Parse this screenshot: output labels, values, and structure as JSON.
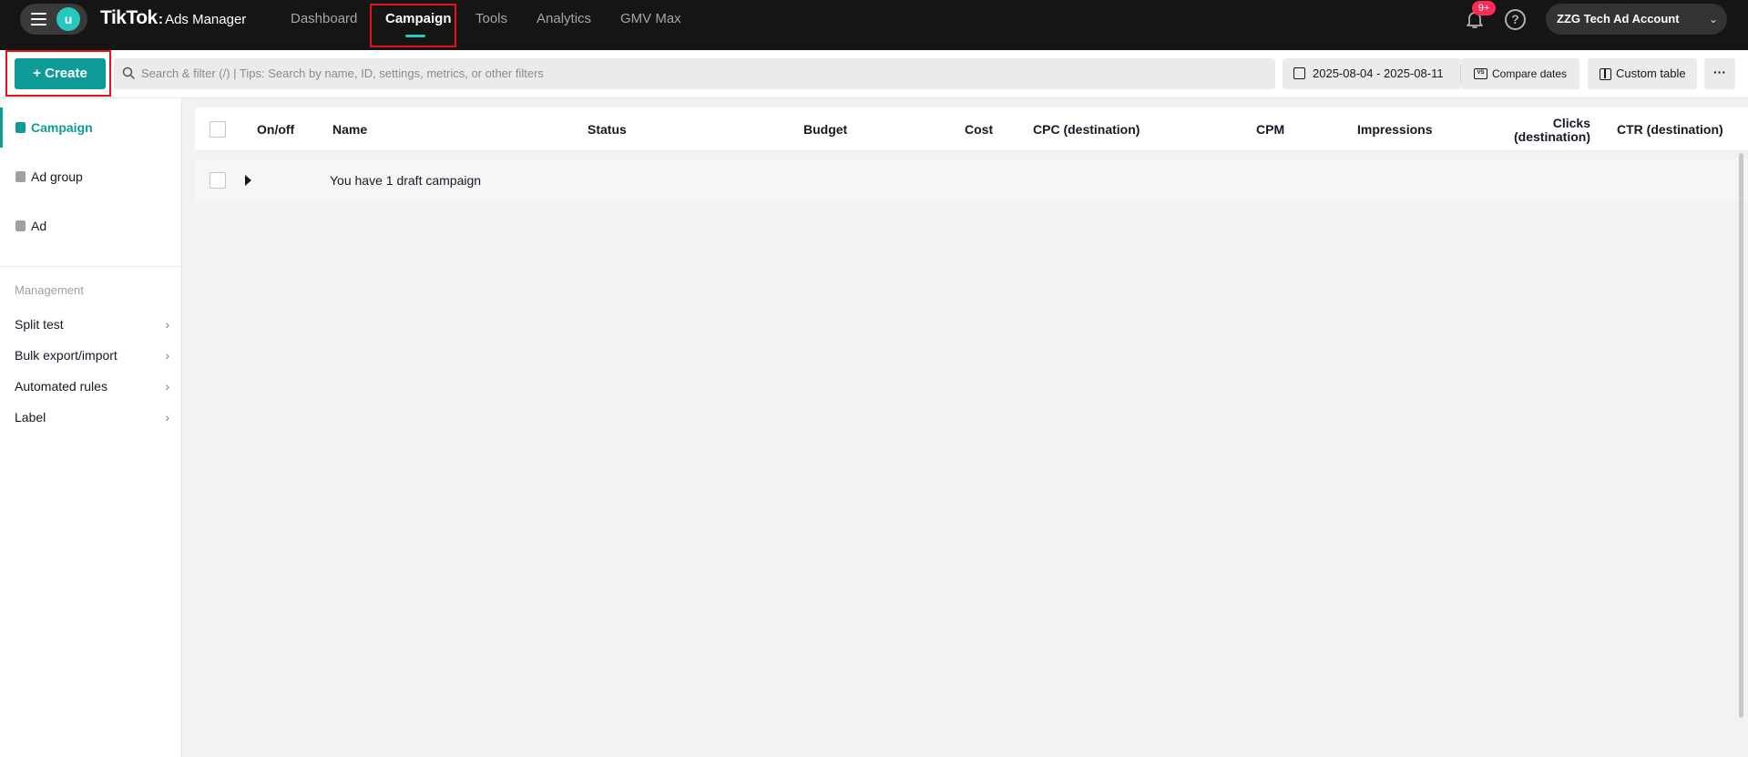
{
  "topbar": {
    "avatar_letter": "u",
    "brand": {
      "tiktok": "TikTok",
      "separator": ":",
      "product": "Ads Manager"
    },
    "nav": [
      {
        "label": "Dashboard"
      },
      {
        "label": "Campaign",
        "active": true
      },
      {
        "label": "Tools"
      },
      {
        "label": "Analytics"
      },
      {
        "label": "GMV Max"
      }
    ],
    "notifications_badge": "9+",
    "help_glyph": "?",
    "account_name": "ZZG Tech Ad Account",
    "account_chevron": "⌄"
  },
  "toolbar": {
    "create_label": "+ Create",
    "search_placeholder": "Search & filter (/) | Tips: Search by name, ID, settings, metrics, or other filters",
    "date_range": "2025-08-04 - 2025-08-11",
    "compare_icon_text": "VS",
    "compare_label": "Compare dates",
    "custom_table_label": "Custom table",
    "more_label": "···"
  },
  "sidebar": {
    "items": [
      {
        "label": "Campaign",
        "icon": "folder-icon",
        "active": true
      },
      {
        "label": "Ad group",
        "icon": "ad-group-icon"
      },
      {
        "label": "Ad",
        "icon": "ad-icon"
      }
    ],
    "management_heading": "Management",
    "management_items": [
      {
        "label": "Split test"
      },
      {
        "label": "Bulk export/import"
      },
      {
        "label": "Automated rules"
      },
      {
        "label": "Label"
      }
    ],
    "arrow_glyph": "›"
  },
  "table": {
    "columns": [
      "On/off",
      "Name",
      "Status",
      "Budget",
      "Cost",
      "CPC (destination)",
      "CPM",
      "Impressions",
      "Clicks (destination)",
      "CTR (destination)"
    ],
    "clicks_header_lines": [
      "Clicks",
      "(destination)"
    ],
    "draft_row_text": "You have 1 draft campaign"
  },
  "colors": {
    "accent": "#0f9b97",
    "highlight_box": "#e8101d",
    "topbar_bg": "#151515"
  }
}
